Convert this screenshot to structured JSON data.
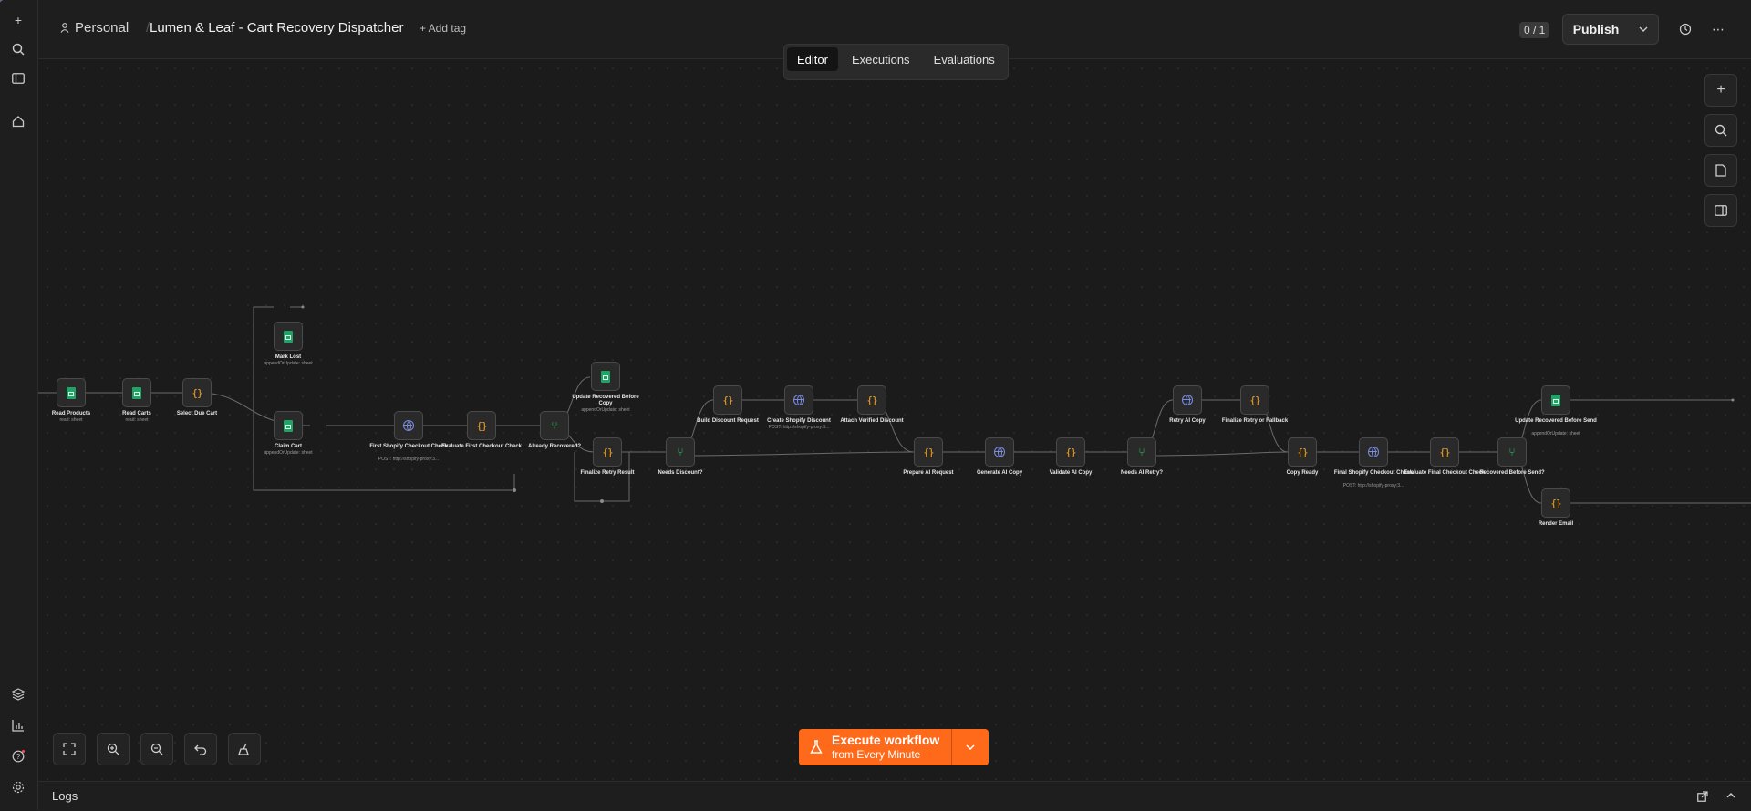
{
  "header": {
    "project": "Personal",
    "workflow_title": "Lumen & Leaf - Cart Recovery Dispatcher",
    "add_tag": "+ Add tag",
    "tabs": [
      "Editor",
      "Executions",
      "Evaluations"
    ],
    "active_tab": "Editor",
    "publish_count": "0 / 1",
    "publish_label": "Publish"
  },
  "execute": {
    "line1": "Execute workflow",
    "line2": "from Every Minute"
  },
  "logs": {
    "label": "Logs"
  },
  "nodes": {
    "read_products": {
      "label": "Read Products",
      "sub": "read: sheet"
    },
    "read_carts": {
      "label": "Read Carts",
      "sub": "read: sheet"
    },
    "select_due_cart": {
      "label": "Select Due Cart"
    },
    "mark_lost": {
      "label": "Mark Lost",
      "sub": "appendOrUpdate: sheet"
    },
    "claim_cart": {
      "label": "Claim Cart",
      "sub": "appendOrUpdate: sheet"
    },
    "first_shopify_check": {
      "label": "First Shopify Checkout Check",
      "sub": "POST: http://shopify-proxy:3..."
    },
    "evaluate_first_check": {
      "label": "Evaluate First Checkout Check"
    },
    "already_recovered": {
      "label": "Already Recovered?"
    },
    "update_recovered_before_copy": {
      "label": "Update Recovered Before Copy",
      "sub": "appendOrUpdate: sheet"
    },
    "overlap_node": {
      "label": "Finalize Retry Result"
    },
    "needs_discount": {
      "label": "Needs Discount?"
    },
    "build_discount_request": {
      "label": "Build Discount Request"
    },
    "create_shopify_discount": {
      "label": "Create Shopify Discount",
      "sub": "POST: http://shopify-proxy:3..."
    },
    "attach_verified_discount": {
      "label": "Attach Verified Discount"
    },
    "prepare_ai_request": {
      "label": "Prepare AI Request"
    },
    "generate_ai_copy": {
      "label": "Generate AI Copy"
    },
    "validate_ai_copy": {
      "label": "Validate AI Copy"
    },
    "needs_ai_retry": {
      "label": "Needs AI Retry?"
    },
    "retry_ai_copy": {
      "label": "Retry AI Copy"
    },
    "finalize_retry": {
      "label": "Finalize Retry or Fallback"
    },
    "copy_ready": {
      "label": "Copy Ready"
    },
    "final_shopify_check": {
      "label": "Final Shopify Checkout Check",
      "sub": "POST: http://shopify-proxy:3..."
    },
    "evaluate_final_check": {
      "label": "Evaluate Final Checkout Check"
    },
    "recovered_before_send": {
      "label": "Recovered Before Send?"
    },
    "update_recovered_before_send": {
      "label": "Update Recovered Before Send",
      "sub": "appendOrUpdate: sheet"
    },
    "render_email": {
      "label": "Render Email"
    }
  }
}
